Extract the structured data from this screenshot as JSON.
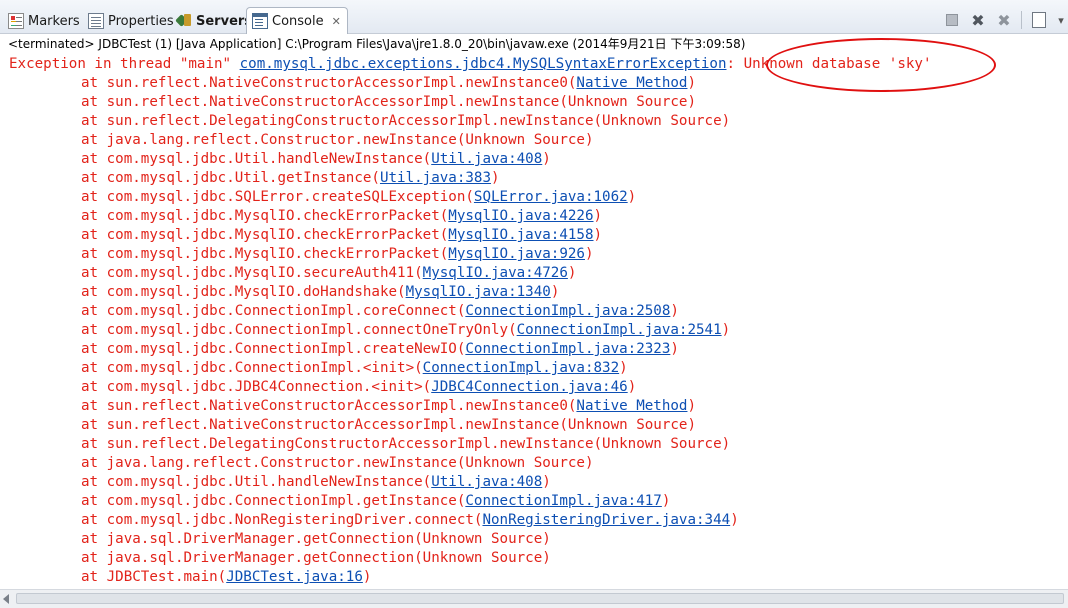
{
  "tabs": [
    {
      "id": "markers",
      "label": "Markers",
      "icon": "markers-icon"
    },
    {
      "id": "properties",
      "label": "Properties",
      "icon": "properties-icon"
    },
    {
      "id": "servers",
      "label": "Servers",
      "icon": "servers-icon"
    },
    {
      "id": "console",
      "label": "Console",
      "icon": "console-icon",
      "active": true,
      "close": "✕"
    }
  ],
  "toolbar": {
    "terminate_icon": "stop-icon",
    "remove_launch_icon": "remove-launch-icon",
    "remove_all_icon": "remove-all-terminated-icon",
    "scroll_lock_icon": "scroll-lock-icon",
    "more_icon": "view-menu-icon",
    "remove_glyph": "✖",
    "remove_all_glyph": "✖",
    "more_glyph": "▾"
  },
  "status": "<terminated> JDBCTest (1) [Java Application] C:\\Program Files\\Java\\jre1.8.0_20\\bin\\javaw.exe (2014年9月21日 下午3:09:58)",
  "console": {
    "first_line": {
      "prefix": "Exception in thread \"main\" ",
      "link": "com.mysql.jdbc.exceptions.jdbc4.MySQLSyntaxErrorException",
      "suffix": ": Unknown database 'sky'"
    },
    "frames": [
      {
        "text": "at sun.reflect.NativeConstructorAccessorImpl.newInstance0(",
        "link": "Native Method",
        "end": ")"
      },
      {
        "text": "at sun.reflect.NativeConstructorAccessorImpl.newInstance(Unknown Source)",
        "link": "",
        "end": ""
      },
      {
        "text": "at sun.reflect.DelegatingConstructorAccessorImpl.newInstance(Unknown Source)",
        "link": "",
        "end": ""
      },
      {
        "text": "at java.lang.reflect.Constructor.newInstance(Unknown Source)",
        "link": "",
        "end": ""
      },
      {
        "text": "at com.mysql.jdbc.Util.handleNewInstance(",
        "link": "Util.java:408",
        "end": ")"
      },
      {
        "text": "at com.mysql.jdbc.Util.getInstance(",
        "link": "Util.java:383",
        "end": ")"
      },
      {
        "text": "at com.mysql.jdbc.SQLError.createSQLException(",
        "link": "SQLError.java:1062",
        "end": ")"
      },
      {
        "text": "at com.mysql.jdbc.MysqlIO.checkErrorPacket(",
        "link": "MysqlIO.java:4226",
        "end": ")"
      },
      {
        "text": "at com.mysql.jdbc.MysqlIO.checkErrorPacket(",
        "link": "MysqlIO.java:4158",
        "end": ")"
      },
      {
        "text": "at com.mysql.jdbc.MysqlIO.checkErrorPacket(",
        "link": "MysqlIO.java:926",
        "end": ")"
      },
      {
        "text": "at com.mysql.jdbc.MysqlIO.secureAuth411(",
        "link": "MysqlIO.java:4726",
        "end": ")"
      },
      {
        "text": "at com.mysql.jdbc.MysqlIO.doHandshake(",
        "link": "MysqlIO.java:1340",
        "end": ")"
      },
      {
        "text": "at com.mysql.jdbc.ConnectionImpl.coreConnect(",
        "link": "ConnectionImpl.java:2508",
        "end": ")"
      },
      {
        "text": "at com.mysql.jdbc.ConnectionImpl.connectOneTryOnly(",
        "link": "ConnectionImpl.java:2541",
        "end": ")"
      },
      {
        "text": "at com.mysql.jdbc.ConnectionImpl.createNewIO(",
        "link": "ConnectionImpl.java:2323",
        "end": ")"
      },
      {
        "text": "at com.mysql.jdbc.ConnectionImpl.<init>(",
        "link": "ConnectionImpl.java:832",
        "end": ")"
      },
      {
        "text": "at com.mysql.jdbc.JDBC4Connection.<init>(",
        "link": "JDBC4Connection.java:46",
        "end": ")"
      },
      {
        "text": "at sun.reflect.NativeConstructorAccessorImpl.newInstance0(",
        "link": "Native Method",
        "end": ")"
      },
      {
        "text": "at sun.reflect.NativeConstructorAccessorImpl.newInstance(Unknown Source)",
        "link": "",
        "end": ""
      },
      {
        "text": "at sun.reflect.DelegatingConstructorAccessorImpl.newInstance(Unknown Source)",
        "link": "",
        "end": ""
      },
      {
        "text": "at java.lang.reflect.Constructor.newInstance(Unknown Source)",
        "link": "",
        "end": ""
      },
      {
        "text": "at com.mysql.jdbc.Util.handleNewInstance(",
        "link": "Util.java:408",
        "end": ")"
      },
      {
        "text": "at com.mysql.jdbc.ConnectionImpl.getInstance(",
        "link": "ConnectionImpl.java:417",
        "end": ")"
      },
      {
        "text": "at com.mysql.jdbc.NonRegisteringDriver.connect(",
        "link": "NonRegisteringDriver.java:344",
        "end": ")"
      },
      {
        "text": "at java.sql.DriverManager.getConnection(Unknown Source)",
        "link": "",
        "end": ""
      },
      {
        "text": "at java.sql.DriverManager.getConnection(Unknown Source)",
        "link": "",
        "end": ""
      },
      {
        "text": "at JDBCTest.main(",
        "link": "JDBCTest.java:16",
        "end": ")"
      }
    ]
  },
  "colors": {
    "error_text": "#e2231a",
    "link_text": "#0d4fb3",
    "annotation": "#e01010"
  }
}
